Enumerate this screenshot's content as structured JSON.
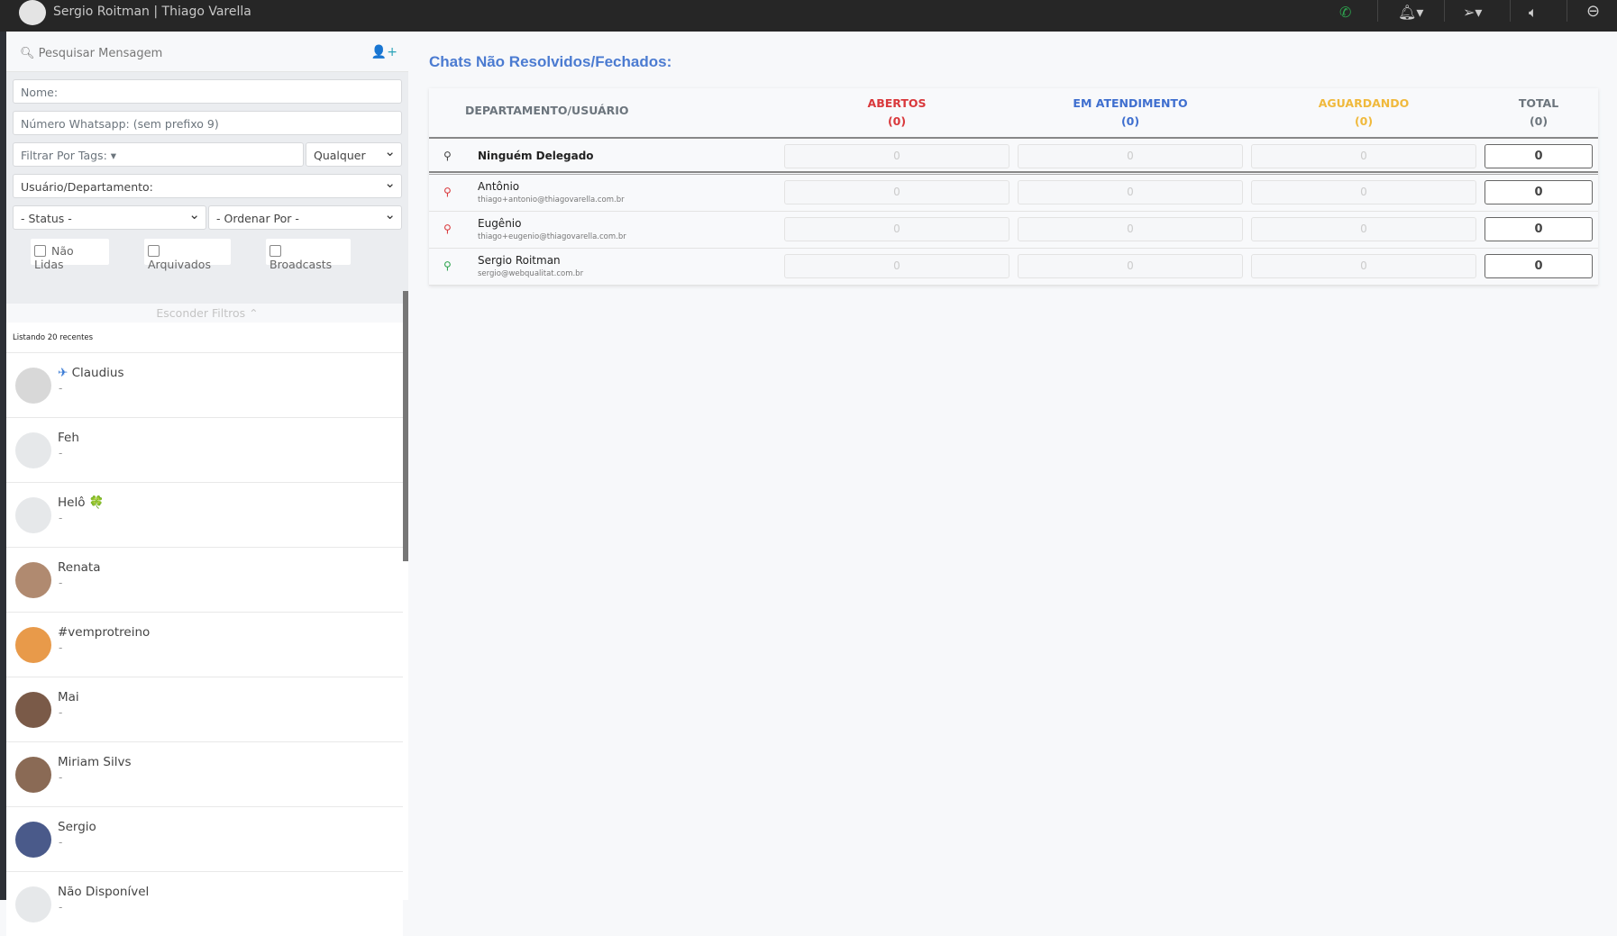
{
  "topbar": {
    "title": "Sergio Roitman | Thiago Varella",
    "icons": [
      "whatsapp-icon",
      "bell-icon",
      "send-icon",
      "volume-icon",
      "logout-icon"
    ]
  },
  "sidebar": {
    "search_label": "Pesquisar Mensagem",
    "name_placeholder": "Nome:",
    "whatsapp_placeholder": "Número Whatsapp: (sem prefixo 9)",
    "tags_label": "Filtrar Por Tags:",
    "tags_mode": "Qualquer",
    "user_dept": "Usuário/Departamento:",
    "status": "- Status -",
    "order": "- Ordenar Por -",
    "checkboxes": [
      "Não Lidas",
      "Arquivados",
      "Broadcasts"
    ],
    "hide_filters": "Esconder Filtros",
    "listing": "Listando 20 recentes",
    "chats": [
      {
        "name": "Claudius",
        "emoji": "✈",
        "msg": "-",
        "color": "#d8d8d8"
      },
      {
        "name": "Feh",
        "msg": "-",
        "color": "#e6e8ea"
      },
      {
        "name": "Helô",
        "emoji": "🍀",
        "msg": "-",
        "color": "#e6e8ea"
      },
      {
        "name": "Renata",
        "msg": "-",
        "color": "#b08a70"
      },
      {
        "name": "#vemprotreino",
        "msg": "-",
        "color": "#e89a4a"
      },
      {
        "name": "Mai",
        "msg": "-",
        "color": "#7a5a48"
      },
      {
        "name": "Miriam Silvs",
        "msg": "-",
        "color": "#8a6a55"
      },
      {
        "name": "Sergio",
        "msg": "-",
        "color": "#4a5a8a"
      },
      {
        "name": "Não Disponível",
        "msg": "-",
        "color": "#e6e8ea"
      }
    ]
  },
  "main": {
    "title": "Chats Não Resolvidos/Fechados:",
    "headers": {
      "dept": "DEPARTAMENTO/USUÁRIO",
      "open": "ABERTOS",
      "open_count": "(0)",
      "serving": "EM ATENDIMENTO",
      "serving_count": "(0)",
      "waiting": "AGUARDANDO",
      "waiting_count": "(0)",
      "total": "TOTAL",
      "total_count": "(0)"
    },
    "colors": {
      "open": "#d9383b",
      "serving": "#3f6fcf",
      "waiting": "#f0b93c",
      "total": "#6c757d"
    },
    "rows": [
      {
        "name": "Ninguém Delegado",
        "email": "",
        "open": "0",
        "serving": "0",
        "waiting": "0",
        "total": "0"
      },
      {
        "name": "Antônio",
        "email": "thiago+antonio@thiagovarella.com.br",
        "open": "0",
        "serving": "0",
        "waiting": "0",
        "total": "0"
      },
      {
        "name": "Eugênio",
        "email": "thiago+eugenio@thiagovarella.com.br",
        "open": "0",
        "serving": "0",
        "waiting": "0",
        "total": "0"
      },
      {
        "name": "Sergio Roitman",
        "email": "sergio@webqualitat.com.br",
        "open": "0",
        "serving": "0",
        "waiting": "0",
        "total": "0"
      }
    ]
  }
}
